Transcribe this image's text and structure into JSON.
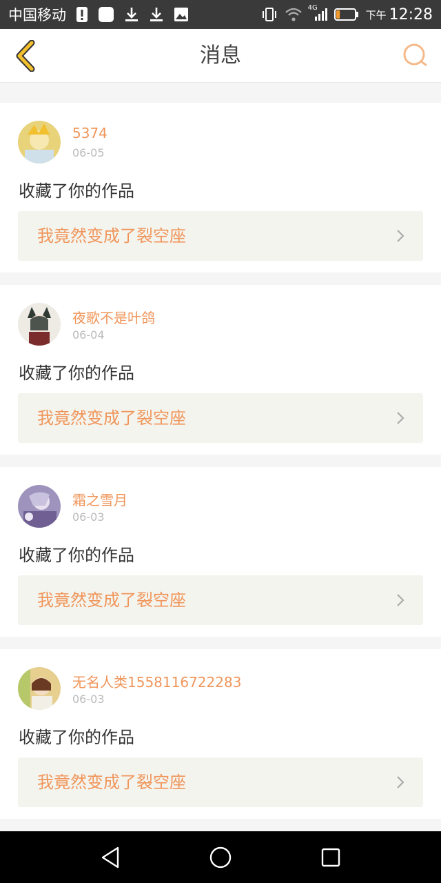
{
  "status_bar": {
    "carrier": "中国移动",
    "network": "4G",
    "time_ampm": "下午",
    "time": "12:28",
    "battery_fill": 0.2,
    "icons": [
      "alert-icon",
      "app-icon",
      "download-icon",
      "download-icon",
      "image-icon",
      "vibrate-icon",
      "wifi-icon",
      "signal-icon",
      "battery-icon"
    ]
  },
  "header": {
    "title": "消息",
    "back_icon": "chevron-left-icon",
    "search_icon": "search-icon"
  },
  "messages": [
    {
      "username": "5374",
      "date": "06-05",
      "action": "收藏了你的作品",
      "work_title": "我竟然变成了裂空座",
      "avatar_color": "#e8d27a"
    },
    {
      "username": "夜歌不是叶鸽",
      "date": "06-04",
      "action": "收藏了你的作品",
      "work_title": "我竟然变成了裂空座",
      "avatar_color": "#c9c4bd"
    },
    {
      "username": "霜之雪月",
      "date": "06-03",
      "action": "收藏了你的作品",
      "work_title": "我竟然变成了裂空座",
      "avatar_color": "#a79bc4"
    },
    {
      "username": "无名人类1558116722283",
      "date": "06-03",
      "action": "收藏了你的作品",
      "work_title": "我竟然变成了裂空座",
      "avatar_color": "#d9b57e"
    }
  ],
  "colors": {
    "accent": "#f0955a",
    "back_icon": "#f2c02e",
    "search_icon": "#f5b98a",
    "link_bg": "#f4f4ee"
  },
  "nav": {
    "icons": [
      "back-triangle-icon",
      "home-circle-icon",
      "recents-square-icon"
    ]
  }
}
